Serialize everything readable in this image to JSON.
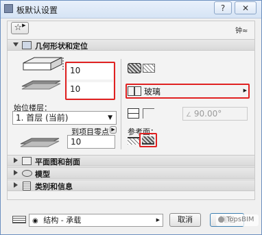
{
  "window": {
    "title": "板默认设置",
    "help_label": "?",
    "close_label": "✕"
  },
  "toolbar": {
    "favorites_icon": "star-icon",
    "right_icon_text": "钟≈"
  },
  "geometry": {
    "header": "几何形状和定位",
    "thickness": "10",
    "offset": "10",
    "home_story_label": "始位楼层：",
    "home_story_value": "1. 首层 (当前)",
    "to_project_zero_label": "到项目零点",
    "to_project_zero_value": "10",
    "material_value": "玻璃",
    "angle_value": "90.00°",
    "reference_plane_label": "参考面："
  },
  "sections": [
    {
      "label": "平面图和剖面"
    },
    {
      "label": "模型"
    },
    {
      "label": "类别和信息"
    }
  ],
  "footer": {
    "layer_value": "结构 - 承载",
    "cancel_label": "取消",
    "ok_label": "确定",
    "watermark": "TopsBIM"
  },
  "colors": {
    "highlight": "#e02020",
    "title_bg": "#dce7f5"
  }
}
